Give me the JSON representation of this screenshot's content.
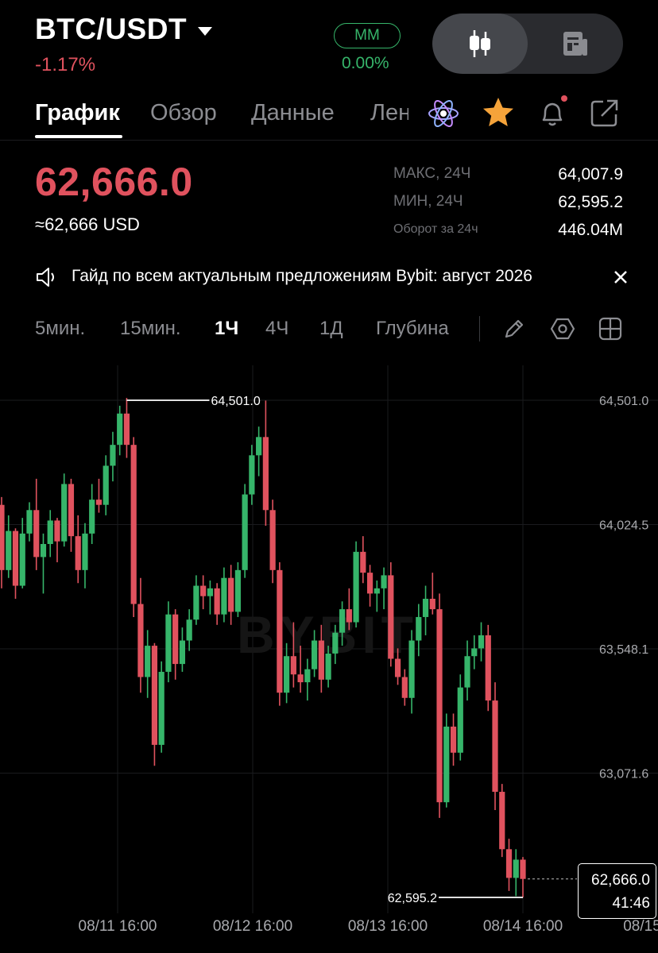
{
  "header": {
    "pair": "BTC/USDT",
    "change_pct": "-1.17%",
    "mm_label": "MM",
    "mm_value": "0.00%",
    "view_toggle": [
      "candlestick-icon",
      "orderbook-icon"
    ]
  },
  "tabs": [
    {
      "label": "График",
      "active": true
    },
    {
      "label": "Обзор",
      "active": false
    },
    {
      "label": "Данные",
      "active": false
    },
    {
      "label": "Лен",
      "active": false
    }
  ],
  "tab_icons": [
    "atom-icon",
    "star-icon",
    "bell-icon",
    "share-icon"
  ],
  "ticker": {
    "last_price": "62,666.0",
    "usd_equiv": "≈62,666 USD",
    "stats": [
      {
        "label": "МАКС, 24Ч",
        "value": "64,007.9"
      },
      {
        "label": "МИН, 24Ч",
        "value": "62,595.2"
      },
      {
        "label": "Оборот за 24ч",
        "value": "446.04M"
      }
    ]
  },
  "announcement": {
    "text": "Гайд по всем актуальным предложениям Bybit: август 2026"
  },
  "intervals": [
    {
      "label": "5мин.",
      "selected": false
    },
    {
      "label": "15мин.",
      "selected": false
    },
    {
      "label": "1Ч",
      "selected": true
    },
    {
      "label": "4Ч",
      "selected": false
    },
    {
      "label": "1Д",
      "selected": false
    },
    {
      "label": "Глубина",
      "selected": false
    }
  ],
  "tool_icons": [
    "pencil-icon",
    "settings-hexagon-icon",
    "layout-grid-icon"
  ],
  "colors": {
    "down": "#e0525e",
    "up": "#36b56a",
    "background": "#000000"
  },
  "chart_data": {
    "type": "candlestick",
    "interval": "1Ч",
    "watermark": "BYBIT",
    "y_ticks": [
      "64,501.0",
      "64,024.5",
      "63,548.1",
      "63,071.6"
    ],
    "y_tick_values": [
      64501.0,
      64024.5,
      63548.1,
      63071.6
    ],
    "x_ticks": [
      "08/11 16:00",
      "08/12 16:00",
      "08/13 16:00",
      "08/14 16:00",
      "08/15"
    ],
    "max_marker": {
      "label": "64,501.0",
      "value": 64501.0
    },
    "min_marker": {
      "label": "62,595.2",
      "value": 62595.2
    },
    "last_price": {
      "label": "62,666.0",
      "value": 62666.0,
      "countdown": "41:46"
    },
    "candles": [
      [
        64100,
        64130,
        63780,
        63850
      ],
      [
        63850,
        64060,
        63820,
        64000
      ],
      [
        64000,
        64010,
        63740,
        63790
      ],
      [
        63790,
        64050,
        63780,
        63990
      ],
      [
        63990,
        64110,
        63960,
        64080
      ],
      [
        64080,
        64200,
        63850,
        63900
      ],
      [
        63900,
        63990,
        63760,
        63950
      ],
      [
        63950,
        64080,
        63900,
        64040
      ],
      [
        64040,
        64050,
        63880,
        63960
      ],
      [
        63960,
        64220,
        63940,
        64180
      ],
      [
        64180,
        64200,
        63920,
        63980
      ],
      [
        63980,
        64060,
        63800,
        63850
      ],
      [
        63850,
        64030,
        63780,
        63990
      ],
      [
        63990,
        64180,
        63950,
        64120
      ],
      [
        64120,
        64200,
        64070,
        64100
      ],
      [
        64100,
        64290,
        64060,
        64250
      ],
      [
        64250,
        64380,
        64190,
        64330
      ],
      [
        64330,
        64480,
        64290,
        64450
      ],
      [
        64450,
        64510,
        64280,
        64330
      ],
      [
        64330,
        64360,
        63670,
        63720
      ],
      [
        63720,
        63820,
        63380,
        63440
      ],
      [
        63440,
        63620,
        63360,
        63560
      ],
      [
        63560,
        63570,
        63100,
        63180
      ],
      [
        63180,
        63500,
        63150,
        63460
      ],
      [
        63460,
        63730,
        63420,
        63680
      ],
      [
        63680,
        63700,
        63430,
        63490
      ],
      [
        63490,
        63630,
        63460,
        63580
      ],
      [
        63580,
        63700,
        63540,
        63660
      ],
      [
        63660,
        63830,
        63640,
        63790
      ],
      [
        63790,
        63830,
        63700,
        63750
      ],
      [
        63750,
        63810,
        63680,
        63780
      ],
      [
        63780,
        63800,
        63640,
        63680
      ],
      [
        63680,
        63860,
        63650,
        63820
      ],
      [
        63820,
        63870,
        63640,
        63690
      ],
      [
        63690,
        63880,
        63670,
        63850
      ],
      [
        63850,
        64180,
        63820,
        64140
      ],
      [
        64140,
        64330,
        64100,
        64290
      ],
      [
        64290,
        64400,
        64210,
        64360
      ],
      [
        64360,
        64500,
        64020,
        64080
      ],
      [
        64080,
        64120,
        63800,
        63850
      ],
      [
        63850,
        63880,
        63330,
        63380
      ],
      [
        63380,
        63570,
        63340,
        63520
      ],
      [
        63520,
        63650,
        63400,
        63450
      ],
      [
        63450,
        63560,
        63380,
        63420
      ],
      [
        63420,
        63510,
        63350,
        63470
      ],
      [
        63470,
        63620,
        63440,
        63580
      ],
      [
        63580,
        63640,
        63380,
        63430
      ],
      [
        63430,
        63560,
        63400,
        63530
      ],
      [
        63530,
        63640,
        63490,
        63610
      ],
      [
        63610,
        63730,
        63560,
        63700
      ],
      [
        63700,
        63780,
        63620,
        63650
      ],
      [
        63650,
        63960,
        63630,
        63920
      ],
      [
        63920,
        63980,
        63800,
        63840
      ],
      [
        63840,
        63870,
        63710,
        63760
      ],
      [
        63760,
        63810,
        63690,
        63780
      ],
      [
        63780,
        63860,
        63700,
        63830
      ],
      [
        63830,
        63880,
        63480,
        63510
      ],
      [
        63510,
        63550,
        63410,
        63440
      ],
      [
        63440,
        63470,
        63330,
        63360
      ],
      [
        63360,
        63620,
        63300,
        63580
      ],
      [
        63580,
        63720,
        63520,
        63670
      ],
      [
        63670,
        63790,
        63600,
        63740
      ],
      [
        63740,
        63840,
        63680,
        63700
      ],
      [
        63700,
        63760,
        62900,
        62960
      ],
      [
        62960,
        63300,
        62940,
        63250
      ],
      [
        63250,
        63300,
        63100,
        63150
      ],
      [
        63150,
        63450,
        63120,
        63400
      ],
      [
        63400,
        63580,
        63350,
        63520
      ],
      [
        63520,
        63600,
        63470,
        63550
      ],
      [
        63550,
        63650,
        63500,
        63600
      ],
      [
        63600,
        63640,
        63310,
        63350
      ],
      [
        63350,
        63420,
        62930,
        63000
      ],
      [
        63000,
        63030,
        62750,
        62780
      ],
      [
        62780,
        62820,
        62620,
        62670
      ],
      [
        62670,
        62780,
        62600,
        62740
      ],
      [
        62740,
        62750,
        62595,
        62666
      ]
    ]
  }
}
